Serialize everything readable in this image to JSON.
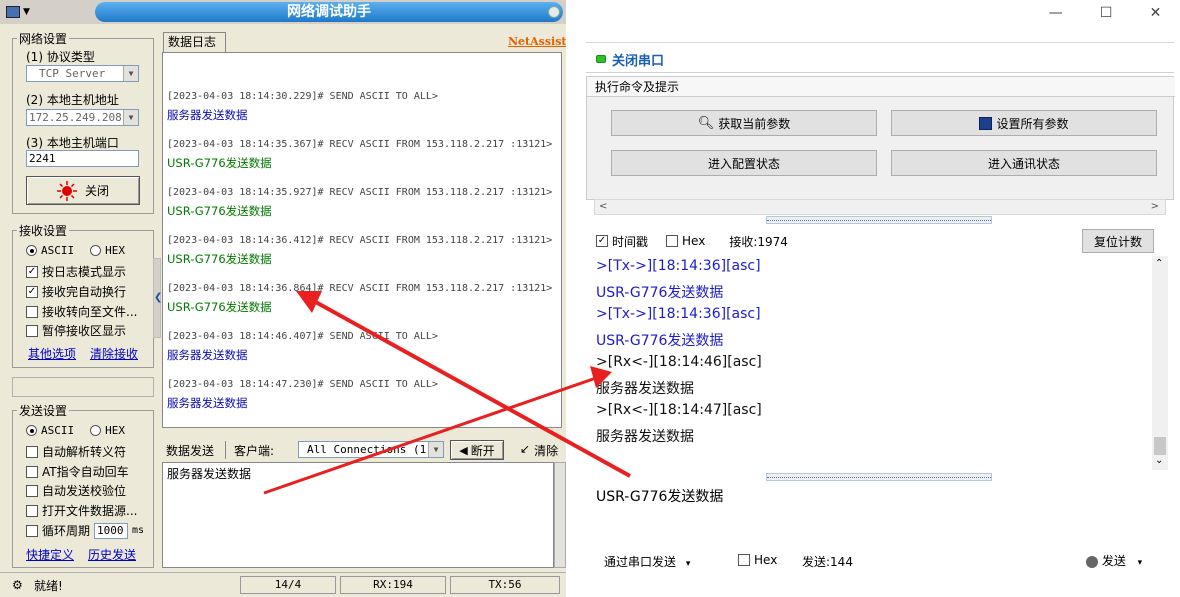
{
  "left_app": {
    "title": "网络调试助手",
    "netassist_link": "NetAssist",
    "network_settings": {
      "legend": "网络设置",
      "protocol_label": "(1) 协议类型",
      "protocol_value": "TCP Server",
      "host_label": "(2) 本地主机地址",
      "host_value": "172.25.249.208",
      "port_label": "(3) 本地主机端口",
      "port_value": "2241",
      "close_button": "关闭"
    },
    "receive_settings": {
      "legend": "接收设置",
      "ascii": "ASCII",
      "hex": "HEX",
      "opt_log_mode": "按日志模式显示",
      "opt_auto_wrap": "接收完自动换行",
      "opt_to_file": "接收转向至文件...",
      "opt_pause": "暂停接收区显示",
      "link_more": "其他选项",
      "link_clear": "清除接收"
    },
    "send_settings": {
      "legend": "发送设置",
      "ascii": "ASCII",
      "hex": "HEX",
      "opt_escape": "自动解析转义符",
      "opt_at": "AT指令自动回车",
      "opt_checksum": "自动发送校验位",
      "opt_file": "打开文件数据源...",
      "opt_loop": "循环周期",
      "loop_value": "1000",
      "loop_unit": "ms",
      "link_shortcut": "快捷定义",
      "link_history": "历史发送"
    },
    "log_tab": "数据日志",
    "log": [
      {
        "head": "",
        "msg": "服务器发送数据",
        "dir": "send"
      },
      {
        "head": "[2023-04-03 18:14:30.229]# SEND ASCII TO ALL>",
        "msg": "服务器发送数据",
        "dir": "send"
      },
      {
        "head": "[2023-04-03 18:14:35.367]# RECV ASCII FROM 153.118.2.217 :13121>",
        "msg": "USR-G776发送数据",
        "dir": "recv"
      },
      {
        "head": "[2023-04-03 18:14:35.927]# RECV ASCII FROM 153.118.2.217 :13121>",
        "msg": "USR-G776发送数据",
        "dir": "recv"
      },
      {
        "head": "[2023-04-03 18:14:36.412]# RECV ASCII FROM 153.118.2.217 :13121>",
        "msg": "USR-G776发送数据",
        "dir": "recv"
      },
      {
        "head": "[2023-04-03 18:14:36.864]# RECV ASCII FROM 153.118.2.217 :13121>",
        "msg": "USR-G776发送数据",
        "dir": "recv"
      },
      {
        "head": "[2023-04-03 18:14:46.407]# SEND ASCII TO ALL>",
        "msg": "服务器发送数据",
        "dir": "send"
      },
      {
        "head": "[2023-04-03 18:14:47.230]# SEND ASCII TO ALL>",
        "msg": "服务器发送数据",
        "dir": "send"
      }
    ],
    "send_bar": {
      "tab": "数据发送",
      "client_label": "客户端:",
      "client_value": "All Connections (1)",
      "disconnect": "断开",
      "clear": "清除"
    },
    "send_text": "服务器发送数据",
    "status": {
      "ready": "就绪!",
      "count": "14/4",
      "rx": "RX:194",
      "tx": "TX:56"
    }
  },
  "right_app": {
    "close_port": "关闭串口",
    "cmd_header": "执行命令及提示",
    "btn_get_params": "获取当前参数",
    "btn_set_params": "设置所有参数",
    "btn_config_mode": "进入配置状态",
    "btn_comm_mode": "进入通讯状态",
    "rx_toolbar": {
      "timestamp": "时间戳",
      "hex": "Hex",
      "rx_count": "接收:1974",
      "reset": "复位计数"
    },
    "rx_lines": [
      {
        "text": ">[Tx->][18:14:36][asc]",
        "color": "#1c1ccc"
      },
      {
        "text": "USR-G776发送数据",
        "color": "#1c1ccc"
      },
      {
        "text": ">[Tx->][18:14:36][asc]",
        "color": "#1c1ccc"
      },
      {
        "text": "USR-G776发送数据",
        "color": "#1c1ccc"
      },
      {
        "text": ">[Rx<-][18:14:46][asc]",
        "color": "#111111"
      },
      {
        "text": "服务器发送数据",
        "color": "#111111"
      },
      {
        "text": ">[Rx<-][18:14:47][asc]",
        "color": "#111111"
      },
      {
        "text": "服务器发送数据",
        "color": "#111111"
      }
    ],
    "tx_text": "USR-G776发送数据",
    "tx_toolbar": {
      "send_via": "通过串口发送",
      "hex": "Hex",
      "tx_count": "发送:144",
      "send": "发送"
    }
  },
  "colors": {
    "title_blue": "#1f79c8",
    "annotation_red": "#e82020",
    "led_green": "#2ec12e"
  }
}
